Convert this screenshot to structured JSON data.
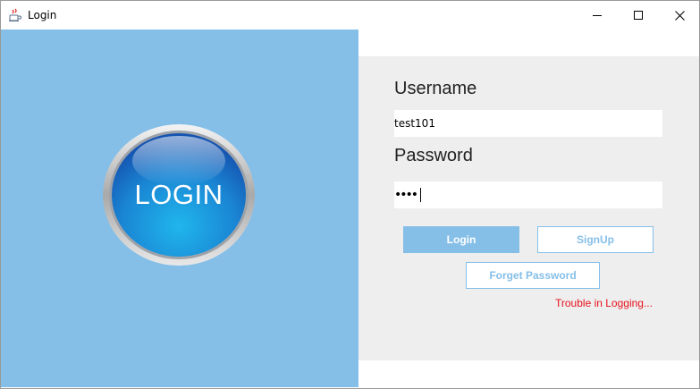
{
  "window": {
    "title": "Login",
    "icons": {
      "app": "java-coffee-cup-icon",
      "minimize": "minimize-icon",
      "maximize": "maximize-icon",
      "close": "close-icon"
    }
  },
  "left": {
    "badge_text": "LOGIN",
    "colors": {
      "panel": "#85bfe8",
      "badge": "#1e74c8"
    }
  },
  "form": {
    "username_label": "Username",
    "username_value": "test101",
    "password_label": "Password",
    "password_masked": "••••",
    "login_label": "Login",
    "signup_label": "SignUp",
    "forget_label": "Forget Password",
    "trouble_text": "Trouble in Logging..."
  },
  "colors": {
    "accent": "#85bfe8",
    "error": "#e8101b",
    "panel_bg": "#eeeeee"
  }
}
